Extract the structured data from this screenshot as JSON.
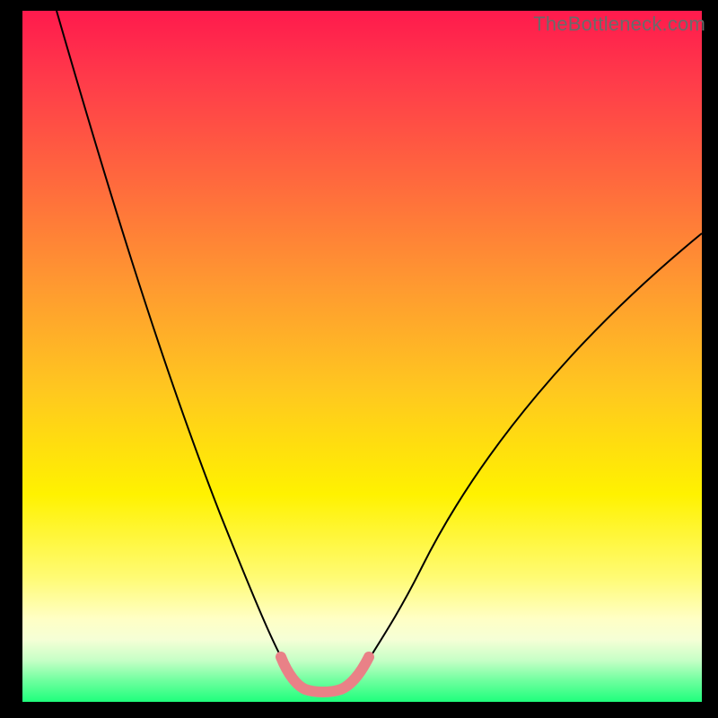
{
  "watermark": "TheBottleneck.com",
  "chart_data": {
    "type": "line",
    "title": "",
    "xlabel": "",
    "ylabel": "",
    "xlim": [
      0,
      100
    ],
    "ylim": [
      0,
      100
    ],
    "series": [
      {
        "name": "bottleneck-curve",
        "x": [
          5,
          10,
          15,
          20,
          25,
          30,
          35,
          40,
          42,
          45,
          48,
          50,
          55,
          60,
          65,
          70,
          75,
          80,
          85,
          90,
          95,
          100
        ],
        "values": [
          100,
          88,
          76,
          64,
          52,
          40,
          28,
          14,
          6,
          2,
          2,
          6,
          15,
          24,
          32,
          39,
          46,
          52,
          58,
          63,
          67,
          71
        ]
      }
    ],
    "annotations": [
      {
        "name": "valley-highlight",
        "x_range": [
          39,
          51
        ],
        "y_level": 3
      }
    ],
    "background_gradient": {
      "type": "vertical",
      "stops": [
        {
          "pos": 0,
          "color": "#ff1a4d"
        },
        {
          "pos": 25,
          "color": "#ff6a3d"
        },
        {
          "pos": 55,
          "color": "#ffc81f"
        },
        {
          "pos": 82,
          "color": "#fffb74"
        },
        {
          "pos": 100,
          "color": "#1fff7c"
        }
      ]
    }
  }
}
